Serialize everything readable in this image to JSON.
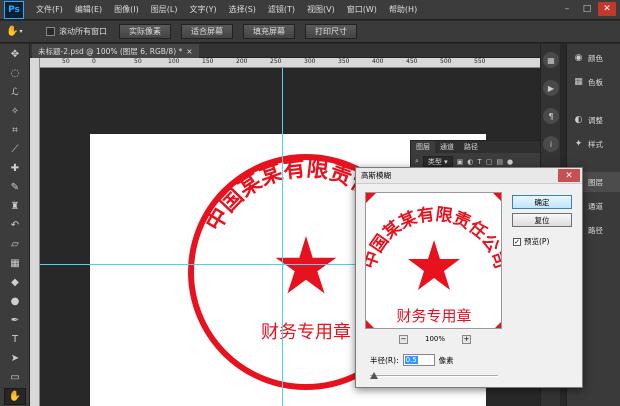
{
  "app": {
    "logo": "Ps"
  },
  "menu": [
    "文件(F)",
    "编辑(E)",
    "图像(I)",
    "图层(L)",
    "文字(Y)",
    "选择(S)",
    "滤镜(T)",
    "视图(V)",
    "窗口(W)",
    "帮助(H)"
  ],
  "window_controls": {
    "minimize": "–",
    "restore": "□",
    "close": "✕"
  },
  "options_bar": {
    "scroll_all_label": "滚动所有窗口",
    "buttons": [
      "实际像素",
      "适合屏幕",
      "填充屏幕",
      "打印尺寸"
    ]
  },
  "document": {
    "tab_title": "未标题-2.psd @ 100% (图层 6, RGB/8) *",
    "tab_close": "×"
  },
  "ruler_ticks": [
    "50",
    "0",
    "50",
    "100",
    "150",
    "200",
    "250",
    "300",
    "350",
    "400",
    "450",
    "500",
    "550"
  ],
  "stamp": {
    "arc_text": "中国某某有限责任公司",
    "center_text": "财务专用章",
    "color": "#e8121e"
  },
  "right_panel": {
    "items": [
      "颜色",
      "色板",
      "调整",
      "样式",
      "图层",
      "通道",
      "路径"
    ]
  },
  "layers_panel": {
    "tabs": [
      "图层",
      "通道",
      "路径"
    ],
    "filter_label": "类型"
  },
  "dialog": {
    "title": "高斯模糊",
    "close": "✕",
    "ok": "确定",
    "reset": "复位",
    "preview_label": "预览(P)",
    "preview_checked": true,
    "zoom": "100%",
    "zoom_minus": "−",
    "zoom_plus": "+",
    "radius_label": "半径(R):",
    "radius_value": "0.5",
    "radius_unit": "像素"
  },
  "icons": {
    "tools": [
      "move-icon",
      "marquee-icon",
      "lasso-icon",
      "magic-wand-icon",
      "crop-icon",
      "eyedropper-icon",
      "healing-brush-icon",
      "brush-icon",
      "clone-stamp-icon",
      "history-brush-icon",
      "eraser-icon",
      "gradient-icon",
      "blur-icon",
      "dodge-icon",
      "pen-icon",
      "type-icon",
      "path-selection-icon",
      "shape-icon",
      "hand-icon",
      "zoom-icon"
    ]
  }
}
